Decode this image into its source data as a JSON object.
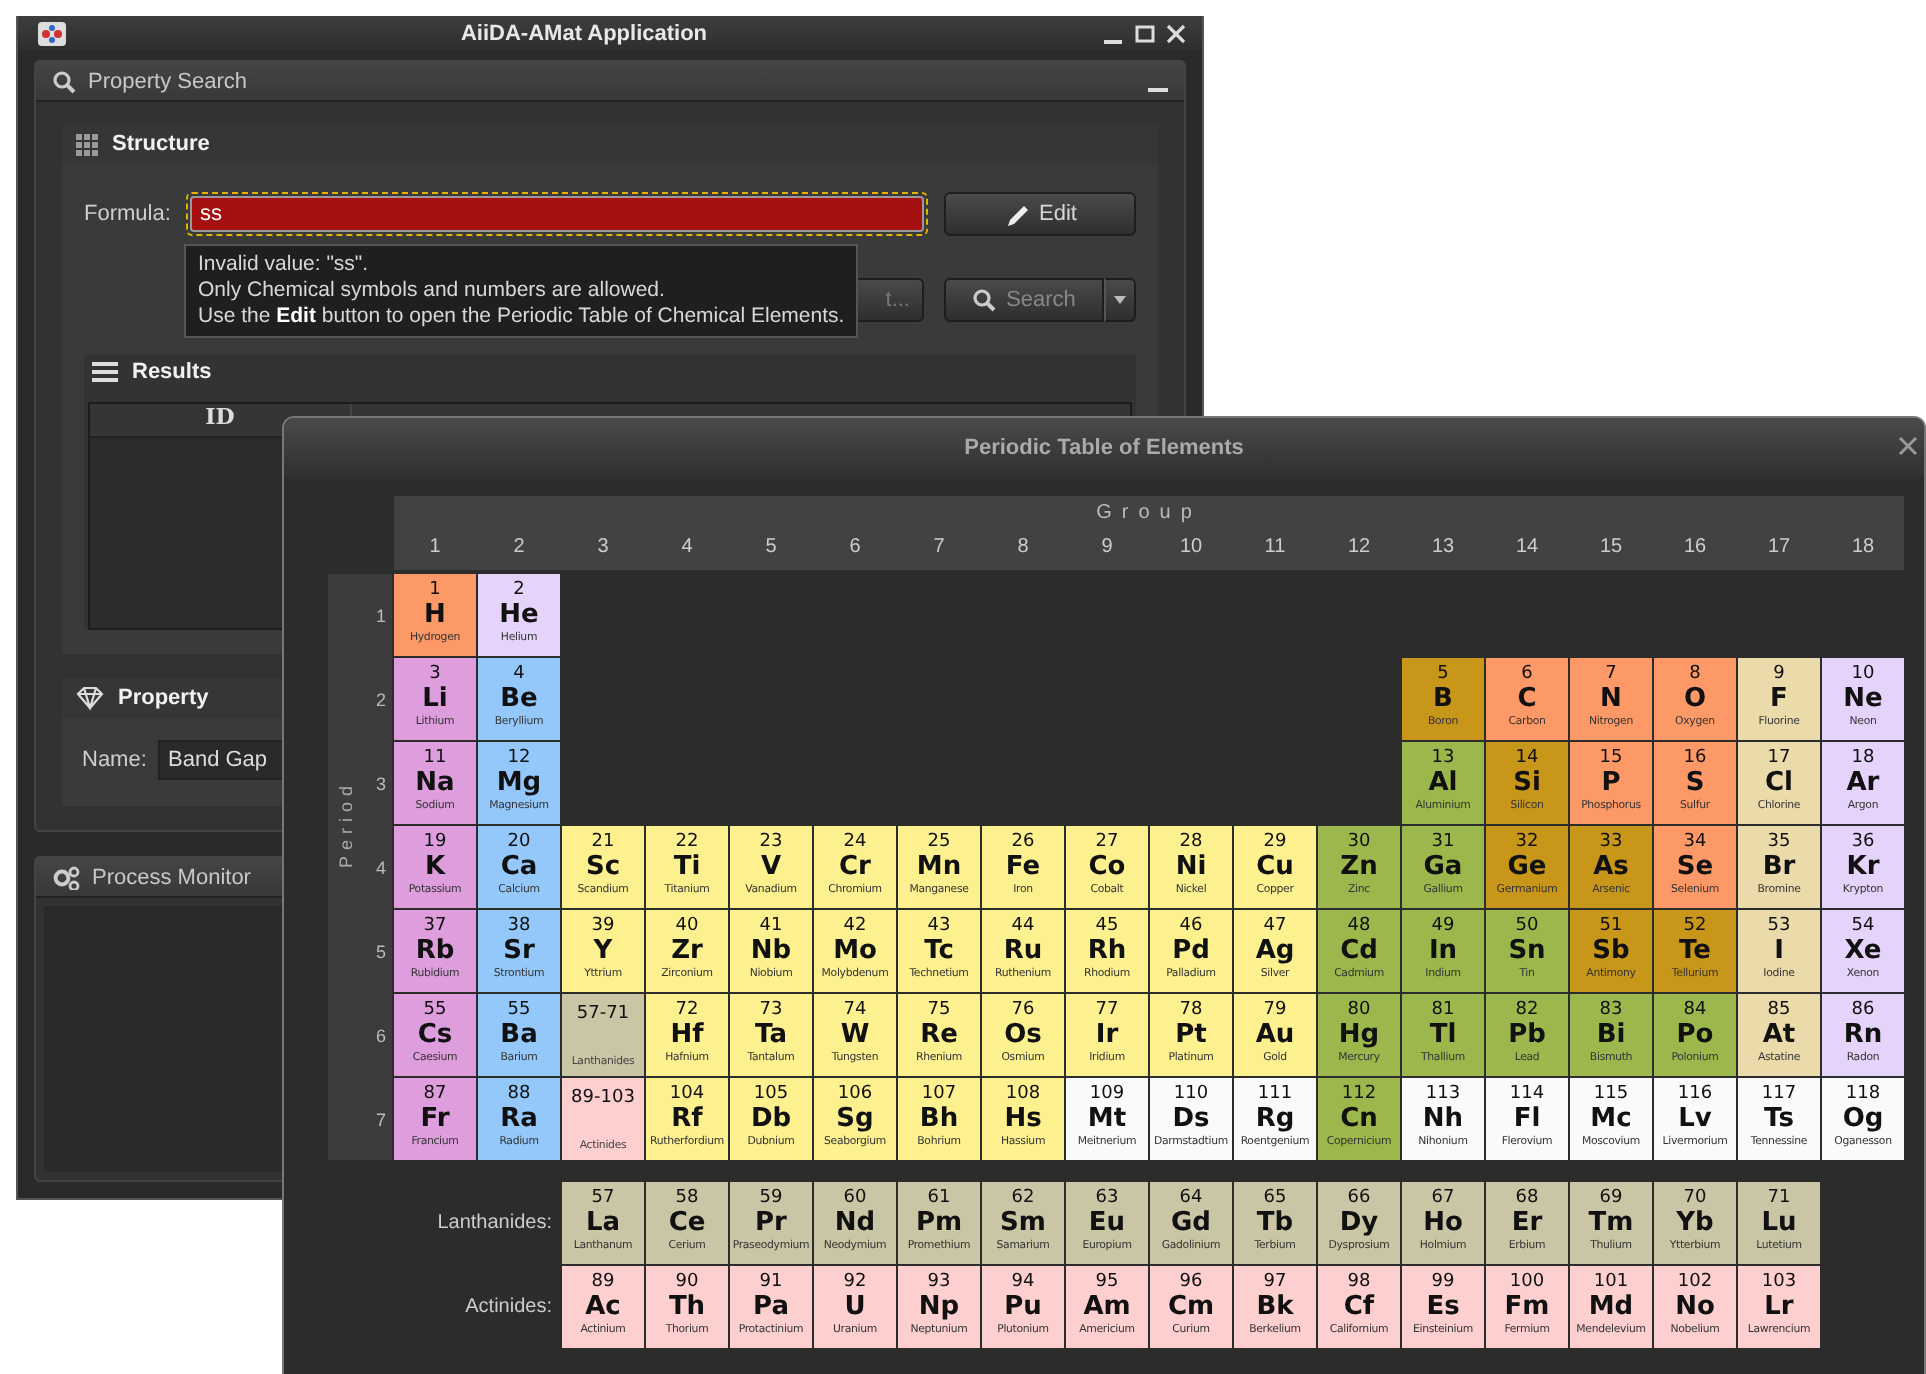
{
  "app_window": {
    "title": "AiiDA-AMat Application",
    "property_search": {
      "title": "Property Search",
      "structure": {
        "title": "Structure",
        "formula_label": "Formula:",
        "formula_value": "ss",
        "invalid": true,
        "edit_button": "Edit",
        "covered_button": "t...",
        "search_button": "Search",
        "tooltip": [
          "Invalid value: \"ss\".",
          "Only Chemical symbols and numbers are allowed.",
          "Use the **Edit** button to open the Periodic Table of Chemical Elements."
        ],
        "results": {
          "title": "Results",
          "columns": [
            "ID"
          ]
        }
      },
      "property": {
        "title": "Property",
        "name_label": "Name:",
        "name_value": "Band Gap"
      }
    },
    "process_monitor": {
      "title": "Process Monitor"
    }
  },
  "dialog": {
    "title": "Periodic Table of Elements",
    "group_title": "Group",
    "groups": [
      "1",
      "2",
      "3",
      "4",
      "5",
      "6",
      "7",
      "8",
      "9",
      "10",
      "11",
      "12",
      "13",
      "14",
      "15",
      "16",
      "17",
      "18"
    ],
    "period_title": "Period",
    "periods": [
      {
        "label": "1",
        "elements": [
          {
            "kind": "element",
            "number": "1",
            "symbol": "H",
            "name": "Hydrogen",
            "color": "#fd9966"
          },
          {
            "kind": "element",
            "number": "2",
            "symbol": "He",
            "name": "Helium",
            "color": "#e6d3fb"
          }
        ]
      },
      {
        "label": "2",
        "elements": [
          {
            "kind": "element",
            "number": "3",
            "symbol": "Li",
            "name": "Lithium",
            "color": "#de9ede"
          },
          {
            "kind": "element",
            "number": "4",
            "symbol": "Be",
            "name": "Beryllium",
            "color": "#94c8fb"
          },
          {
            "kind": "element",
            "number": "5",
            "symbol": "B",
            "name": "Boron",
            "color": "#c89618"
          },
          {
            "kind": "element",
            "number": "6",
            "symbol": "C",
            "name": "Carbon",
            "color": "#fd9966"
          },
          {
            "kind": "element",
            "number": "7",
            "symbol": "N",
            "name": "Nitrogen",
            "color": "#fd9966"
          },
          {
            "kind": "element",
            "number": "8",
            "symbol": "O",
            "name": "Oxygen",
            "color": "#fd9966"
          },
          {
            "kind": "element",
            "number": "9",
            "symbol": "F",
            "name": "Fluorine",
            "color": "#ecdbaa"
          },
          {
            "kind": "element",
            "number": "10",
            "symbol": "Ne",
            "name": "Neon",
            "color": "#e6d3fb"
          }
        ]
      },
      {
        "label": "3",
        "elements": [
          {
            "kind": "element",
            "number": "11",
            "symbol": "Na",
            "name": "Sodium",
            "color": "#de9ede"
          },
          {
            "kind": "element",
            "number": "12",
            "symbol": "Mg",
            "name": "Magnesium",
            "color": "#94c8fb"
          },
          {
            "kind": "element",
            "number": "13",
            "symbol": "Al",
            "name": "Aluminium",
            "color": "#9cb84c"
          },
          {
            "kind": "element",
            "number": "14",
            "symbol": "Si",
            "name": "Silicon",
            "color": "#c89618"
          },
          {
            "kind": "element",
            "number": "15",
            "symbol": "P",
            "name": "Phosphorus",
            "color": "#fd9966"
          },
          {
            "kind": "element",
            "number": "16",
            "symbol": "S",
            "name": "Sulfur",
            "color": "#fd9966"
          },
          {
            "kind": "element",
            "number": "17",
            "symbol": "Cl",
            "name": "Chlorine",
            "color": "#ecdbaa"
          },
          {
            "kind": "element",
            "number": "18",
            "symbol": "Ar",
            "name": "Argon",
            "color": "#e6d3fb"
          }
        ]
      },
      {
        "label": "4",
        "elements": [
          {
            "kind": "element",
            "number": "19",
            "symbol": "K",
            "name": "Potassium",
            "color": "#de9ede"
          },
          {
            "kind": "element",
            "number": "20",
            "symbol": "Ca",
            "name": "Calcium",
            "color": "#94c8fb"
          },
          {
            "kind": "element",
            "number": "21",
            "symbol": "Sc",
            "name": "Scandium",
            "color": "#fdf08f"
          },
          {
            "kind": "element",
            "number": "22",
            "symbol": "Ti",
            "name": "Titanium",
            "color": "#fdf08f"
          },
          {
            "kind": "element",
            "number": "23",
            "symbol": "V",
            "name": "Vanadium",
            "color": "#fdf08f"
          },
          {
            "kind": "element",
            "number": "24",
            "symbol": "Cr",
            "name": "Chromium",
            "color": "#fdf08f"
          },
          {
            "kind": "element",
            "number": "25",
            "symbol": "Mn",
            "name": "Manganese",
            "color": "#fdf08f"
          },
          {
            "kind": "element",
            "number": "26",
            "symbol": "Fe",
            "name": "Iron",
            "color": "#fdf08f"
          },
          {
            "kind": "element",
            "number": "27",
            "symbol": "Co",
            "name": "Cobalt",
            "color": "#fdf08f"
          },
          {
            "kind": "element",
            "number": "28",
            "symbol": "Ni",
            "name": "Nickel",
            "color": "#fdf08f"
          },
          {
            "kind": "element",
            "number": "29",
            "symbol": "Cu",
            "name": "Copper",
            "color": "#fdf08f"
          },
          {
            "kind": "element",
            "number": "30",
            "symbol": "Zn",
            "name": "Zinc",
            "color": "#9cb84c"
          },
          {
            "kind": "element",
            "number": "31",
            "symbol": "Ga",
            "name": "Gallium",
            "color": "#9cb84c"
          },
          {
            "kind": "element",
            "number": "32",
            "symbol": "Ge",
            "name": "Germanium",
            "color": "#c89618"
          },
          {
            "kind": "element",
            "number": "33",
            "symbol": "As",
            "name": "Arsenic",
            "color": "#c89618"
          },
          {
            "kind": "element",
            "number": "34",
            "symbol": "Se",
            "name": "Selenium",
            "color": "#fd9966"
          },
          {
            "kind": "element",
            "number": "35",
            "symbol": "Br",
            "name": "Bromine",
            "color": "#ecdbaa"
          },
          {
            "kind": "element",
            "number": "36",
            "symbol": "Kr",
            "name": "Krypton",
            "color": "#e6d3fb"
          }
        ]
      },
      {
        "label": "5",
        "elements": [
          {
            "kind": "element",
            "number": "37",
            "symbol": "Rb",
            "name": "Rubidium",
            "color": "#de9ede"
          },
          {
            "kind": "element",
            "number": "38",
            "symbol": "Sr",
            "name": "Strontium",
            "color": "#94c8fb"
          },
          {
            "kind": "element",
            "number": "39",
            "symbol": "Y",
            "name": "Yttrium",
            "color": "#fdf08f"
          },
          {
            "kind": "element",
            "number": "40",
            "symbol": "Zr",
            "name": "Zirconium",
            "color": "#fdf08f"
          },
          {
            "kind": "element",
            "number": "41",
            "symbol": "Nb",
            "name": "Niobium",
            "color": "#fdf08f"
          },
          {
            "kind": "element",
            "number": "42",
            "symbol": "Mo",
            "name": "Molybdenum",
            "color": "#fdf08f"
          },
          {
            "kind": "element",
            "number": "43",
            "symbol": "Tc",
            "name": "Technetium",
            "color": "#fdf08f"
          },
          {
            "kind": "element",
            "number": "44",
            "symbol": "Ru",
            "name": "Ruthenium",
            "color": "#fdf08f"
          },
          {
            "kind": "element",
            "number": "45",
            "symbol": "Rh",
            "name": "Rhodium",
            "color": "#fdf08f"
          },
          {
            "kind": "element",
            "number": "46",
            "symbol": "Pd",
            "name": "Palladium",
            "color": "#fdf08f"
          },
          {
            "kind": "element",
            "number": "47",
            "symbol": "Ag",
            "name": "Silver",
            "color": "#fdf08f"
          },
          {
            "kind": "element",
            "number": "48",
            "symbol": "Cd",
            "name": "Cadmium",
            "color": "#9cb84c"
          },
          {
            "kind": "element",
            "number": "49",
            "symbol": "In",
            "name": "Indium",
            "color": "#9cb84c"
          },
          {
            "kind": "element",
            "number": "50",
            "symbol": "Sn",
            "name": "Tin",
            "color": "#9cb84c"
          },
          {
            "kind": "element",
            "number": "51",
            "symbol": "Sb",
            "name": "Antimony",
            "color": "#c89618"
          },
          {
            "kind": "element",
            "number": "52",
            "symbol": "Te",
            "name": "Tellurium",
            "color": "#c89618"
          },
          {
            "kind": "element",
            "number": "53",
            "symbol": "I",
            "name": "Iodine",
            "color": "#ecdbaa"
          },
          {
            "kind": "element",
            "number": "54",
            "symbol": "Xe",
            "name": "Xenon",
            "color": "#e6d3fb"
          }
        ]
      },
      {
        "label": "6",
        "elements": [
          {
            "kind": "element",
            "number": "55",
            "symbol": "Cs",
            "name": "Caesium",
            "color": "#de9ede"
          },
          {
            "kind": "element",
            "number": "55",
            "symbol": "Ba",
            "name": "Barium",
            "color": "#94c8fb"
          },
          {
            "kind": "series",
            "number": "57-71",
            "name": "Lanthanides",
            "color": "#c9c5a5"
          },
          {
            "kind": "element",
            "number": "72",
            "symbol": "Hf",
            "name": "Hafnium",
            "color": "#fdf08f"
          },
          {
            "kind": "element",
            "number": "73",
            "symbol": "Ta",
            "name": "Tantalum",
            "color": "#fdf08f"
          },
          {
            "kind": "element",
            "number": "74",
            "symbol": "W",
            "name": "Tungsten",
            "color": "#fdf08f"
          },
          {
            "kind": "element",
            "number": "75",
            "symbol": "Re",
            "name": "Rhenium",
            "color": "#fdf08f"
          },
          {
            "kind": "element",
            "number": "76",
            "symbol": "Os",
            "name": "Osmium",
            "color": "#fdf08f"
          },
          {
            "kind": "element",
            "number": "77",
            "symbol": "Ir",
            "name": "Iridium",
            "color": "#fdf08f"
          },
          {
            "kind": "element",
            "number": "78",
            "symbol": "Pt",
            "name": "Platinum",
            "color": "#fdf08f"
          },
          {
            "kind": "element",
            "number": "79",
            "symbol": "Au",
            "name": "Gold",
            "color": "#fdf08f"
          },
          {
            "kind": "element",
            "number": "80",
            "symbol": "Hg",
            "name": "Mercury",
            "color": "#9cb84c"
          },
          {
            "kind": "element",
            "number": "81",
            "symbol": "Tl",
            "name": "Thallium",
            "color": "#9cb84c"
          },
          {
            "kind": "element",
            "number": "82",
            "symbol": "Pb",
            "name": "Lead",
            "color": "#9cb84c"
          },
          {
            "kind": "element",
            "number": "83",
            "symbol": "Bi",
            "name": "Bismuth",
            "color": "#9cb84c"
          },
          {
            "kind": "element",
            "number": "84",
            "symbol": "Po",
            "name": "Polonium",
            "color": "#9cb84c"
          },
          {
            "kind": "element",
            "number": "85",
            "symbol": "At",
            "name": "Astatine",
            "color": "#ecdbaa"
          },
          {
            "kind": "element",
            "number": "86",
            "symbol": "Rn",
            "name": "Radon",
            "color": "#e6d3fb"
          }
        ]
      },
      {
        "label": "7",
        "elements": [
          {
            "kind": "element",
            "number": "87",
            "symbol": "Fr",
            "name": "Francium",
            "color": "#de9ede"
          },
          {
            "kind": "element",
            "number": "88",
            "symbol": "Ra",
            "name": "Radium",
            "color": "#94c8fb"
          },
          {
            "kind": "series",
            "number": "89-103",
            "name": "Actinides",
            "color": "#fdcfcf"
          },
          {
            "kind": "element",
            "number": "104",
            "symbol": "Rf",
            "name": "Rutherfordium",
            "color": "#fdf08f"
          },
          {
            "kind": "element",
            "number": "105",
            "symbol": "Db",
            "name": "Dubnium",
            "color": "#fdf08f"
          },
          {
            "kind": "element",
            "number": "106",
            "symbol": "Sg",
            "name": "Seaborgium",
            "color": "#fdf08f"
          },
          {
            "kind": "element",
            "number": "107",
            "symbol": "Bh",
            "name": "Bohrium",
            "color": "#fdf08f"
          },
          {
            "kind": "element",
            "number": "108",
            "symbol": "Hs",
            "name": "Hassium",
            "color": "#fdf08f"
          },
          {
            "kind": "element",
            "number": "109",
            "symbol": "Mt",
            "name": "Meitnerium",
            "color": "#fafafa"
          },
          {
            "kind": "element",
            "number": "110",
            "symbol": "Ds",
            "name": "Darmstadtium",
            "color": "#fafafa"
          },
          {
            "kind": "element",
            "number": "111",
            "symbol": "Rg",
            "name": "Roentgenium",
            "color": "#fafafa"
          },
          {
            "kind": "element",
            "number": "112",
            "symbol": "Cn",
            "name": "Copernicium",
            "color": "#9cb84c"
          },
          {
            "kind": "element",
            "number": "113",
            "symbol": "Nh",
            "name": "Nihonium",
            "color": "#fafafa"
          },
          {
            "kind": "element",
            "number": "114",
            "symbol": "Fl",
            "name": "Flerovium",
            "color": "#fafafa"
          },
          {
            "kind": "element",
            "number": "115",
            "symbol": "Mc",
            "name": "Moscovium",
            "color": "#fafafa"
          },
          {
            "kind": "element",
            "number": "116",
            "symbol": "Lv",
            "name": "Livermorium",
            "color": "#fafafa"
          },
          {
            "kind": "element",
            "number": "117",
            "symbol": "Ts",
            "name": "Tennessine",
            "color": "#fafafa"
          },
          {
            "kind": "element",
            "number": "118",
            "symbol": "Og",
            "name": "Oganesson",
            "color": "#fafafa"
          }
        ]
      }
    ],
    "series": [
      {
        "label": "Lanthanides:",
        "elements": [
          {
            "kind": "element",
            "number": "57",
            "symbol": "La",
            "name": "Lanthanum",
            "color": "#c9c5a5"
          },
          {
            "kind": "element",
            "number": "58",
            "symbol": "Ce",
            "name": "Cerium",
            "color": "#c9c5a5"
          },
          {
            "kind": "element",
            "number": "59",
            "symbol": "Pr",
            "name": "Praseodymium",
            "color": "#c9c5a5"
          },
          {
            "kind": "element",
            "number": "60",
            "symbol": "Nd",
            "name": "Neodymium",
            "color": "#c9c5a5"
          },
          {
            "kind": "element",
            "number": "61",
            "symbol": "Pm",
            "name": "Promethium",
            "color": "#c9c5a5"
          },
          {
            "kind": "element",
            "number": "62",
            "symbol": "Sm",
            "name": "Samarium",
            "color": "#c9c5a5"
          },
          {
            "kind": "element",
            "number": "63",
            "symbol": "Eu",
            "name": "Europium",
            "color": "#c9c5a5"
          },
          {
            "kind": "element",
            "number": "64",
            "symbol": "Gd",
            "name": "Gadolinium",
            "color": "#c9c5a5"
          },
          {
            "kind": "element",
            "number": "65",
            "symbol": "Tb",
            "name": "Terbium",
            "color": "#c9c5a5"
          },
          {
            "kind": "element",
            "number": "66",
            "symbol": "Dy",
            "name": "Dysprosium",
            "color": "#c9c5a5"
          },
          {
            "kind": "element",
            "number": "67",
            "symbol": "Ho",
            "name": "Holmium",
            "color": "#c9c5a5"
          },
          {
            "kind": "element",
            "number": "68",
            "symbol": "Er",
            "name": "Erbium",
            "color": "#c9c5a5"
          },
          {
            "kind": "element",
            "number": "69",
            "symbol": "Tm",
            "name": "Thulium",
            "color": "#c9c5a5"
          },
          {
            "kind": "element",
            "number": "70",
            "symbol": "Yb",
            "name": "Ytterbium",
            "color": "#c9c5a5"
          },
          {
            "kind": "element",
            "number": "71",
            "symbol": "Lu",
            "name": "Lutetium",
            "color": "#c9c5a5"
          }
        ]
      },
      {
        "label": "Actinides:",
        "elements": [
          {
            "kind": "element",
            "number": "89",
            "symbol": "Ac",
            "name": "Actinium",
            "color": "#fdcfcf"
          },
          {
            "kind": "element",
            "number": "90",
            "symbol": "Th",
            "name": "Thorium",
            "color": "#fdcfcf"
          },
          {
            "kind": "element",
            "number": "91",
            "symbol": "Pa",
            "name": "Protactinium",
            "color": "#fdcfcf"
          },
          {
            "kind": "element",
            "number": "92",
            "symbol": "U",
            "name": "Uranium",
            "color": "#fdcfcf"
          },
          {
            "kind": "element",
            "number": "93",
            "symbol": "Np",
            "name": "Neptunium",
            "color": "#fdcfcf"
          },
          {
            "kind": "element",
            "number": "94",
            "symbol": "Pu",
            "name": "Plutonium",
            "color": "#fdcfcf"
          },
          {
            "kind": "element",
            "number": "95",
            "symbol": "Am",
            "name": "Americium",
            "color": "#fdcfcf"
          },
          {
            "kind": "element",
            "number": "96",
            "symbol": "Cm",
            "name": "Curium",
            "color": "#fdcfcf"
          },
          {
            "kind": "element",
            "number": "97",
            "symbol": "Bk",
            "name": "Berkelium",
            "color": "#fdcfcf"
          },
          {
            "kind": "element",
            "number": "98",
            "symbol": "Cf",
            "name": "Californium",
            "color": "#fdcfcf"
          },
          {
            "kind": "element",
            "number": "99",
            "symbol": "Es",
            "name": "Einsteinium",
            "color": "#fdcfcf"
          },
          {
            "kind": "element",
            "number": "100",
            "symbol": "Fm",
            "name": "Fermium",
            "color": "#fdcfcf"
          },
          {
            "kind": "element",
            "number": "101",
            "symbol": "Md",
            "name": "Mendelevium",
            "color": "#fdcfcf"
          },
          {
            "kind": "element",
            "number": "102",
            "symbol": "No",
            "name": "Nobelium",
            "color": "#fdcfcf"
          },
          {
            "kind": "element",
            "number": "103",
            "symbol": "Lr",
            "name": "Lawrencium",
            "color": "#fdcfcf"
          }
        ]
      }
    ]
  }
}
